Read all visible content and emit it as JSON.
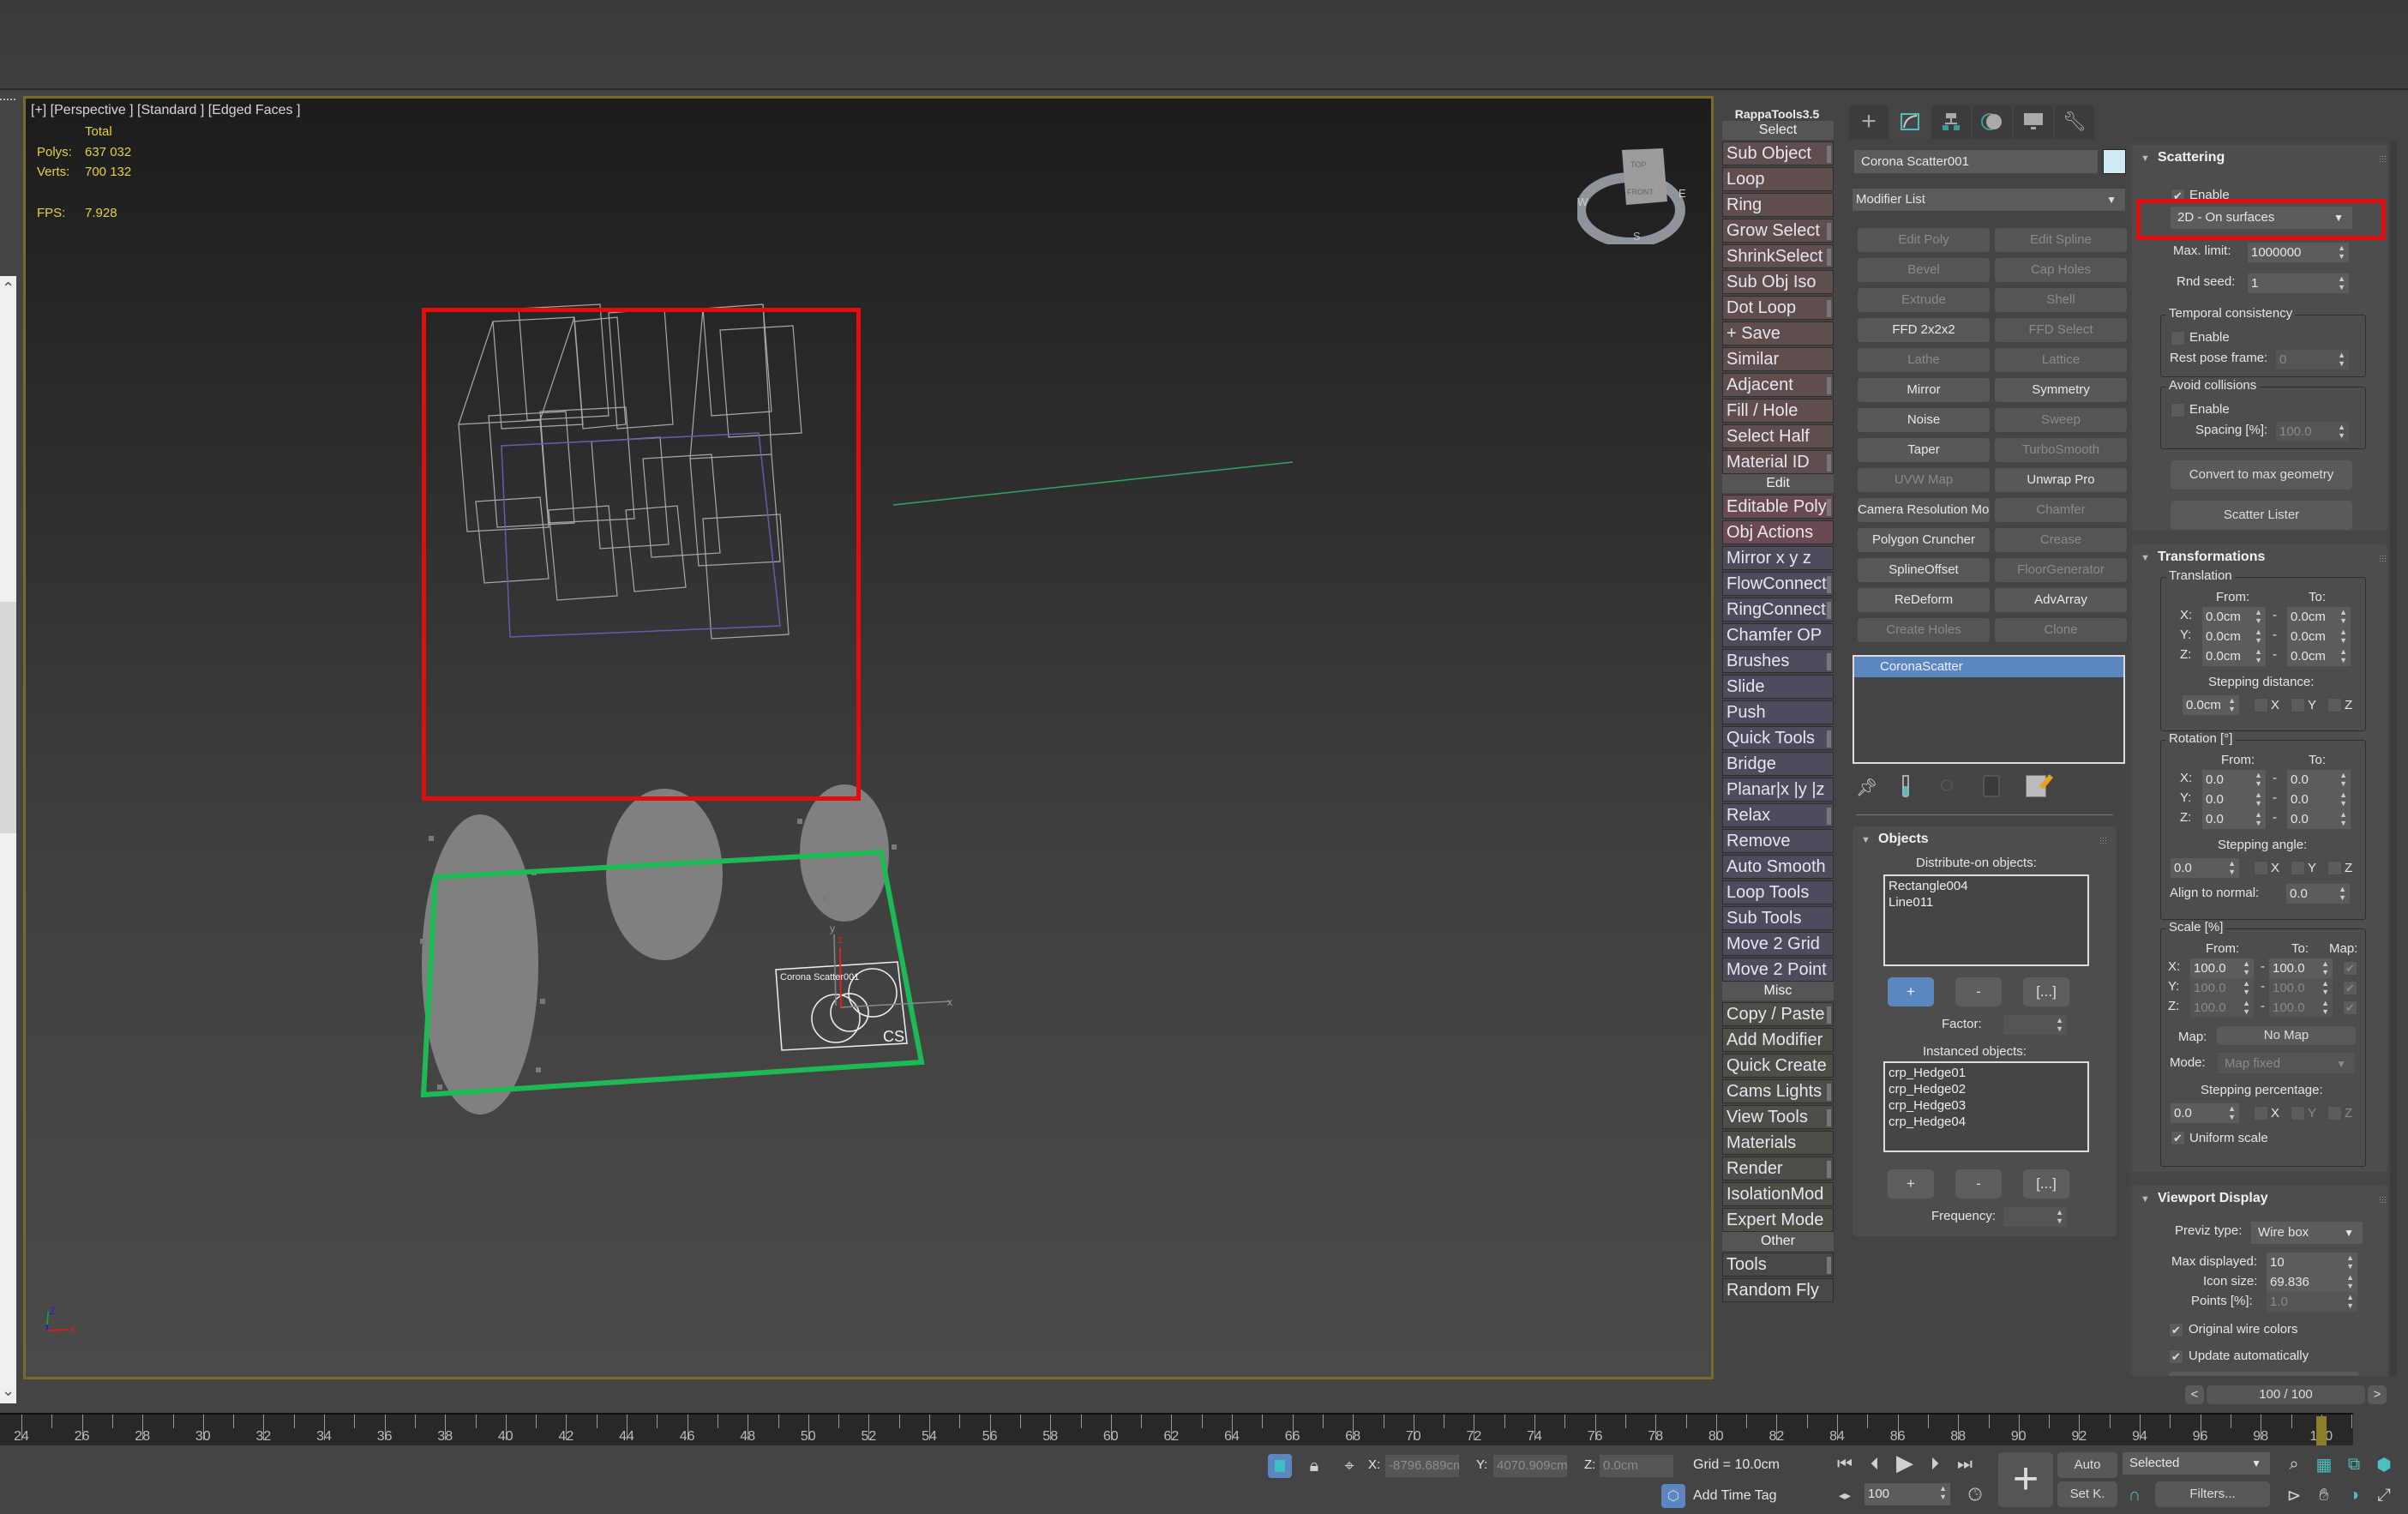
{
  "viewport": {
    "label": "[+] [Perspective ] [Standard ] [Edged Faces ]",
    "stats": {
      "header": "Total",
      "polys_label": "Polys:",
      "polys_value": "637 032",
      "verts_label": "Verts:",
      "verts_value": "700 132",
      "fps_label": "FPS:",
      "fps_value": "7.928"
    },
    "viewcube": {
      "top": "TOP",
      "front": "FRONT",
      "west": "W",
      "east": "E",
      "south": "S"
    },
    "scatter_icon_label": "Corona Scatter001",
    "scatter_icon_mark": "CS",
    "gizmo_axes": {
      "x": "x",
      "y": "y",
      "z": "z"
    },
    "corner_axes": {
      "x": "X",
      "y": "Y",
      "z": "Z"
    },
    "colors": {
      "selection_highlight": "#e10e0e",
      "distribute_spline": "#1db954",
      "viewport_border": "#7a6a2a"
    }
  },
  "rappatools": {
    "title": "RappaTools3.5",
    "sections": [
      {
        "label": "Select",
        "kind": "sel",
        "items": [
          "Sub Object",
          "Loop",
          "Ring",
          "Grow Select",
          "ShrinkSelect",
          "Sub Obj Iso",
          "Dot Loop",
          "+ Save",
          "Similar",
          "Adjacent",
          "Fill / Hole",
          "Select Half",
          "Material ID"
        ]
      },
      {
        "label": "Edit",
        "kind": "edit",
        "items": [
          "Editable Poly",
          "Obj Actions",
          "Mirror  x  y  z",
          "FlowConnect",
          "RingConnect",
          "Chamfer OP",
          "Brushes",
          "Slide",
          "Push",
          "Quick Tools",
          "Bridge",
          "Planar|x |y |z",
          "Relax",
          "Remove",
          "Auto Smooth",
          "Loop Tools",
          "Sub Tools",
          "Move 2 Grid",
          "Move 2 Point"
        ]
      },
      {
        "label": "Misc",
        "kind": "misc",
        "items": [
          "Copy / Paste",
          "Add Modifier",
          "Quick Create",
          "Cams Lights",
          "View Tools",
          "Materials",
          "Render",
          "IsolationMod",
          "Expert Mode"
        ]
      },
      {
        "label": "Other",
        "kind": "oth",
        "items": [
          "Tools",
          "Random Fly"
        ]
      }
    ]
  },
  "command_panel": {
    "tabs": [
      "create-tab",
      "modify-tab",
      "hierarchy-tab",
      "motion-tab",
      "display-tab",
      "utilities-tab"
    ],
    "object_name": "Corona Scatter001",
    "object_color": "#cfeaf2",
    "modifier_list_label": "Modifier List",
    "modifier_buttons": [
      {
        "label": "Edit Poly",
        "enabled": false
      },
      {
        "label": "Edit Spline",
        "enabled": false
      },
      {
        "label": "Bevel",
        "enabled": false
      },
      {
        "label": "Cap Holes",
        "enabled": false
      },
      {
        "label": "Extrude",
        "enabled": false
      },
      {
        "label": "Shell",
        "enabled": false
      },
      {
        "label": "FFD 2x2x2",
        "enabled": true
      },
      {
        "label": "FFD Select",
        "enabled": false
      },
      {
        "label": "Lathe",
        "enabled": false
      },
      {
        "label": "Lattice",
        "enabled": false
      },
      {
        "label": "Mirror",
        "enabled": true
      },
      {
        "label": "Symmetry",
        "enabled": true
      },
      {
        "label": "Noise",
        "enabled": true
      },
      {
        "label": "Sweep",
        "enabled": false
      },
      {
        "label": "Taper",
        "enabled": true
      },
      {
        "label": "TurboSmooth",
        "enabled": false
      },
      {
        "label": "UVW Map",
        "enabled": false
      },
      {
        "label": "Unwrap Pro",
        "enabled": true
      },
      {
        "label": "Camera Resolution Mod",
        "enabled": true
      },
      {
        "label": "Chamfer",
        "enabled": false
      },
      {
        "label": "Polygon Cruncher",
        "enabled": true
      },
      {
        "label": "Crease",
        "enabled": false
      },
      {
        "label": "SplineOffset",
        "enabled": true
      },
      {
        "label": "FloorGenerator",
        "enabled": false
      },
      {
        "label": "ReDeform",
        "enabled": true
      },
      {
        "label": "AdvArray",
        "enabled": true
      },
      {
        "label": "Create Holes",
        "enabled": false
      },
      {
        "label": "Clone",
        "enabled": false
      }
    ],
    "modifier_stack": [
      "CoronaScatter"
    ],
    "stack_tools": [
      "pin-stack-icon",
      "show-end-result-icon",
      "make-unique-icon",
      "remove-modifier-icon",
      "configure-modifier-sets-icon"
    ],
    "objects_rollout": {
      "title": "Objects",
      "distribute_label": "Distribute-on objects:",
      "distribute_objects": [
        "Rectangle004",
        "Line011"
      ],
      "add_label": "+",
      "remove_label": "-",
      "browse_label": "[...]",
      "factor_label": "Factor:",
      "factor_value": "",
      "instanced_label": "Instanced objects:",
      "instanced_objects": [
        "crp_Hedge01",
        "crp_Hedge02",
        "crp_Hedge03",
        "crp_Hedge04"
      ],
      "frequency_label": "Frequency:",
      "frequency_value": ""
    }
  },
  "scattering": {
    "title": "Scattering",
    "enable_label": "Enable",
    "enable_checked": true,
    "mode": "2D - On surfaces",
    "max_limit_label": "Max. limit:",
    "max_limit": "1000000",
    "rnd_seed_label": "Rnd seed:",
    "rnd_seed": "1",
    "temporal": {
      "title": "Temporal consistency",
      "enable_label": "Enable",
      "enable_checked": false,
      "rest_pose_label": "Rest pose frame:",
      "rest_pose": "0"
    },
    "avoid": {
      "title": "Avoid collisions",
      "enable_label": "Enable",
      "enable_checked": false,
      "spacing_label": "Spacing [%]:",
      "spacing": "100.0"
    },
    "convert_label": "Convert to max geometry",
    "lister_label": "Scatter Lister"
  },
  "transformations": {
    "title": "Transformations",
    "translation": {
      "title": "Translation",
      "from_label": "From:",
      "to_label": "To:",
      "rows": [
        {
          "axis": "X:",
          "from": "0.0cm",
          "to": "0.0cm"
        },
        {
          "axis": "Y:",
          "from": "0.0cm",
          "to": "0.0cm"
        },
        {
          "axis": "Z:",
          "from": "0.0cm",
          "to": "0.0cm"
        }
      ],
      "stepping_label": "Stepping distance:",
      "stepping": "0.0cm",
      "axes": [
        "X",
        "Y",
        "Z"
      ]
    },
    "rotation": {
      "title": "Rotation [°]",
      "from_label": "From:",
      "to_label": "To:",
      "rows": [
        {
          "axis": "X:",
          "from": "0.0",
          "to": "0.0"
        },
        {
          "axis": "Y:",
          "from": "0.0",
          "to": "0.0"
        },
        {
          "axis": "Z:",
          "from": "0.0",
          "to": "0.0"
        }
      ],
      "stepping_label": "Stepping angle:",
      "stepping": "0.0",
      "axes": [
        "X",
        "Y",
        "Z"
      ],
      "align_label": "Align to normal:",
      "align": "0.0"
    },
    "scale": {
      "title": "Scale [%]",
      "from_label": "From:",
      "to_label": "To:",
      "map_label": "Map:",
      "rows": [
        {
          "axis": "X:",
          "from": "100.0",
          "to": "100.0"
        },
        {
          "axis": "Y:",
          "from": "100.0",
          "to": "100.0"
        },
        {
          "axis": "Z:",
          "from": "100.0",
          "to": "100.0"
        }
      ],
      "map_row_label": "Map:",
      "map_button": "No Map",
      "mode_label": "Mode:",
      "mode": "Map fixed",
      "stepping_label": "Stepping percentage:",
      "stepping": "0.0",
      "axes": [
        "X",
        "Y",
        "Z"
      ],
      "uniform_label": "Uniform scale",
      "uniform_checked": true
    }
  },
  "viewport_display": {
    "title": "Viewport Display",
    "previz_label": "Previz type:",
    "previz": "Wire box",
    "max_displayed_label": "Max displayed:",
    "max_displayed": "10",
    "icon_size_label": "Icon size:",
    "icon_size": "69.836",
    "points_label": "Points [%]:",
    "points": "1.0",
    "original_wire_label": "Original wire colors",
    "original_wire_checked": true,
    "update_auto_label": "Update automatically",
    "update_auto_checked": true
  },
  "page_nav": {
    "prev": "<",
    "value": "100 / 100",
    "next": ">"
  },
  "timeline": {
    "ticks": [
      "24",
      "26",
      "28",
      "30",
      "32",
      "34",
      "36",
      "38",
      "40",
      "42",
      "44",
      "46",
      "48",
      "50",
      "52",
      "54",
      "56",
      "58",
      "60",
      "62",
      "64",
      "66",
      "68",
      "70",
      "72",
      "74",
      "76",
      "78",
      "80",
      "82",
      "84",
      "86",
      "88",
      "90",
      "92",
      "94",
      "96",
      "98",
      "100"
    ],
    "current_frame": 100
  },
  "status": {
    "x_label": "X:",
    "x_value": "-8796.689cm",
    "y_label": "Y:",
    "y_value": "4070.909cm",
    "z_label": "Z:",
    "z_value": "0.0cm",
    "grid": "Grid = 10.0cm",
    "add_time_tag": "Add Time Tag",
    "frame_value": "100",
    "auto_label": "Auto",
    "setk_label": "Set K.",
    "key_filter": "Selected",
    "filters_label": "Filters..."
  }
}
